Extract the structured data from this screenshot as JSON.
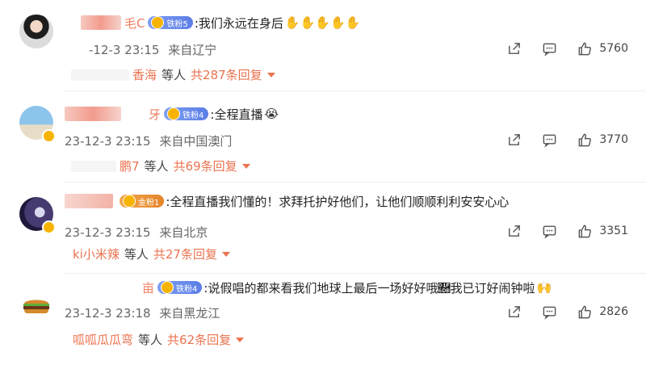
{
  "comments": [
    {
      "name_tail": "毛C",
      "fan_level": "铁粉5",
      "content": ":我们永远在身后",
      "emoji": "✋✋✋✋✋",
      "time": "-12-3 23:15",
      "location": "来自辽宁",
      "likes": "5760",
      "replier": "香海",
      "others": "等人",
      "reply_total": "共287条回复",
      "avatar_icon": "person-avatar"
    },
    {
      "name_tail": "牙",
      "fan_level": "铁粉4",
      "content": ":全程直播",
      "emoji": "😭",
      "time": "23-12-3 23:15",
      "location": "来自中国澳门",
      "likes": "3770",
      "replier": "鹏7",
      "others": "等人",
      "reply_total": "共69条回复",
      "avatar_icon": "beach-avatar"
    },
    {
      "name_tail": "",
      "fan_level": "金粉1",
      "content": ":全程直播我们懂的！求拜托护好他们，让他们顺顺利利安安心心",
      "emoji": "",
      "time": "23-12-3 23:15",
      "location": "来自北京",
      "likes": "3351",
      "replier": "ki小米辣",
      "others": "等人",
      "reply_total": "共27条回复",
      "avatar_icon": "anime-avatar"
    },
    {
      "name_tail": "亩",
      "fan_level": "铁粉4",
      "content": ":说假唱的都来看我们地球上最后一场好好哦🛛我已订好闹钟啦",
      "emoji": "🙌",
      "time": "23-12-3 23:18",
      "location": "来自黑龙江",
      "likes": "2826",
      "replier": "呱呱瓜瓜弯",
      "others": "等人",
      "reply_total": "共62条回复",
      "avatar_icon": "burger-avatar"
    }
  ]
}
